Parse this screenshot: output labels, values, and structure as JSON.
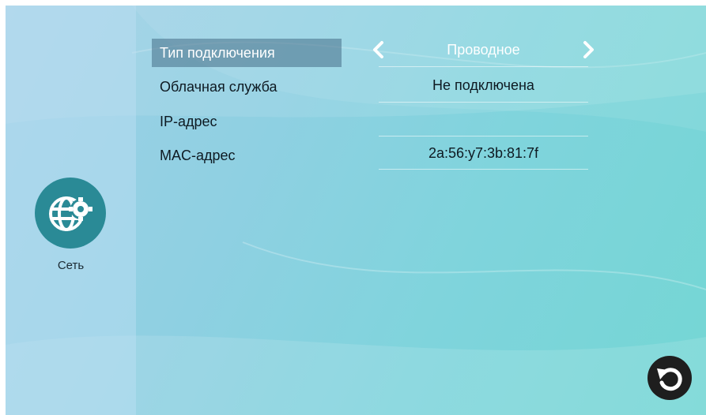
{
  "sidebar": {
    "items": [
      {
        "label": "Сеть",
        "icon": "network-settings-icon"
      }
    ]
  },
  "settings": {
    "rows": [
      {
        "label": "Тип подключения",
        "value": "Проводное",
        "selected": true
      },
      {
        "label": "Облачная служба",
        "value": "Не подключена"
      },
      {
        "label": "IP-адрес",
        "value": ""
      },
      {
        "label": "MAC-адрес",
        "value": "2a:56:y7:3b:81:7f"
      }
    ]
  },
  "controls": {
    "prev_icon": "chevron-left-icon",
    "next_icon": "chevron-right-icon",
    "back_icon": "undo-arrow-icon"
  },
  "colors": {
    "icon_circle": "#2a8a96",
    "selected_row": "#466e87",
    "back_button": "#1e1e1e"
  }
}
